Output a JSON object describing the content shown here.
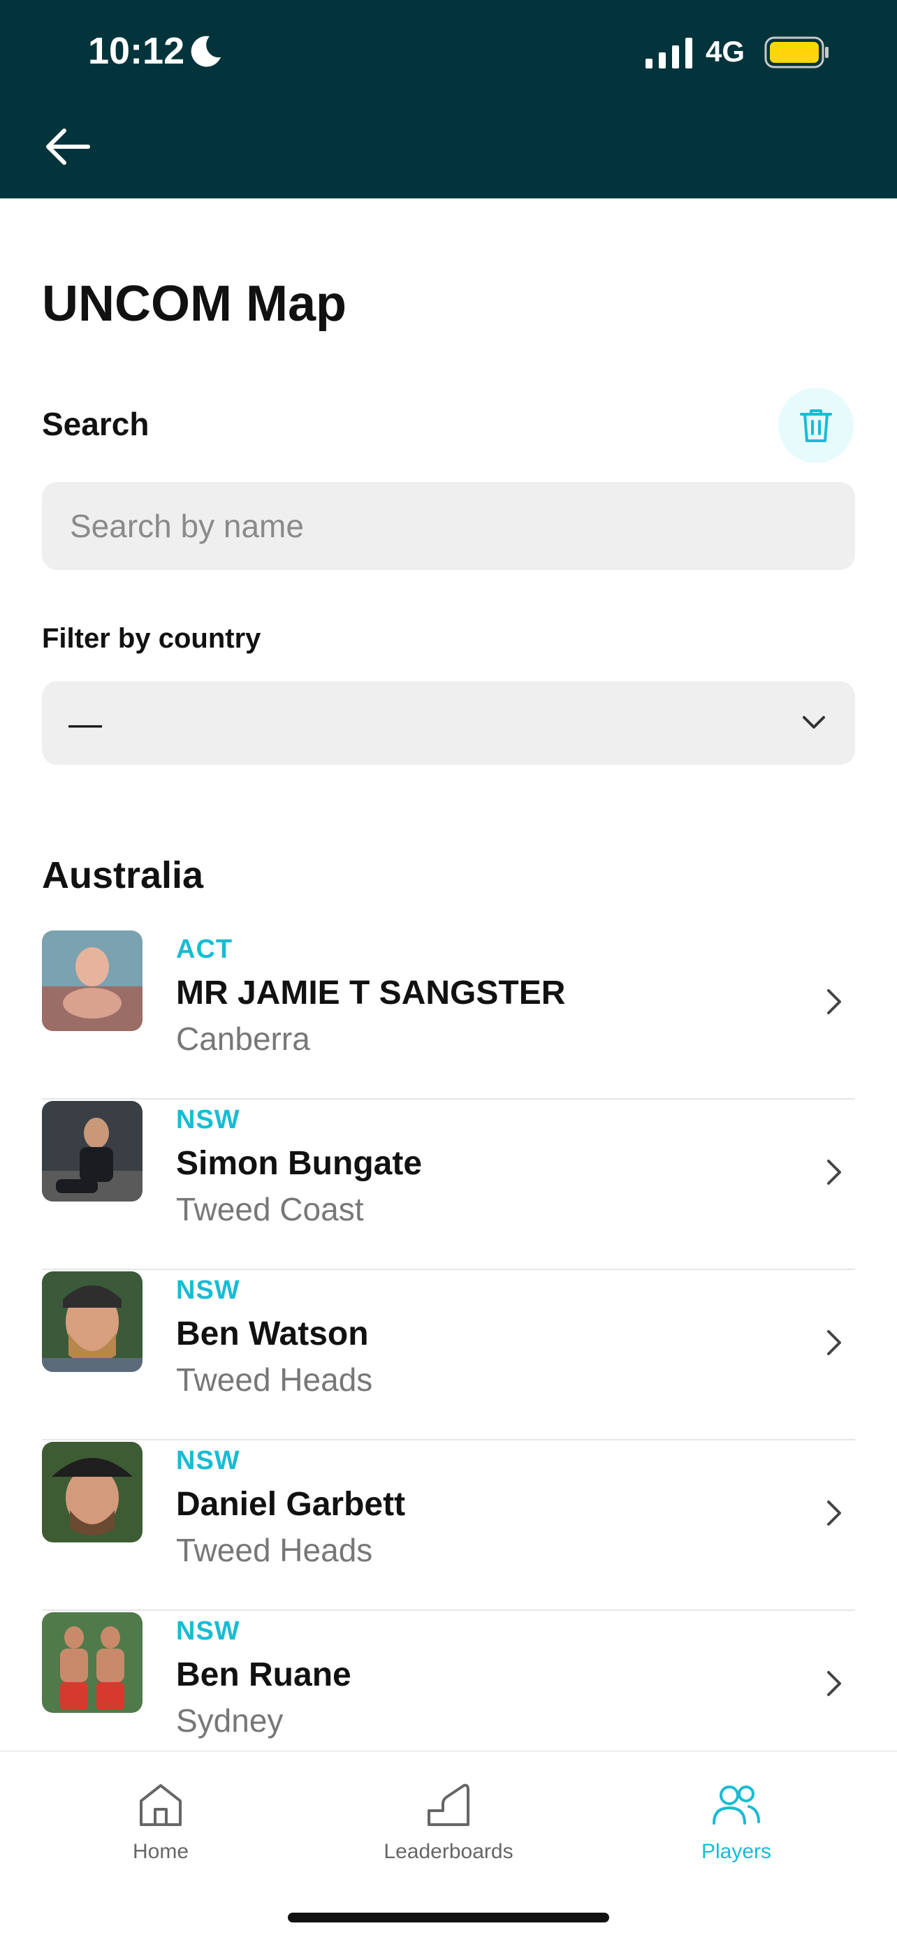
{
  "status_bar": {
    "time": "10:12",
    "network": "4G"
  },
  "page": {
    "title": "UNCOM Map"
  },
  "search": {
    "label": "Search",
    "placeholder": "Search by name",
    "value": ""
  },
  "filter": {
    "label": "Filter by country",
    "selected": "—"
  },
  "section_title": "Australia",
  "players": [
    {
      "region": "ACT",
      "name": "MR JAMIE T SANGSTER",
      "city": "Canberra"
    },
    {
      "region": "NSW",
      "name": "Simon Bungate",
      "city": "Tweed Coast"
    },
    {
      "region": "NSW",
      "name": "Ben Watson",
      "city": "Tweed Heads"
    },
    {
      "region": "NSW",
      "name": "Daniel Garbett",
      "city": "Tweed Heads"
    },
    {
      "region": "NSW",
      "name": "Ben Ruane",
      "city": "Sydney"
    }
  ],
  "tabbar": {
    "home": "Home",
    "leaderboards": "Leaderboards",
    "players": "Players"
  },
  "colors": {
    "header_bg": "#04343b",
    "accent": "#18bcd3",
    "battery": "#ffd60a"
  }
}
